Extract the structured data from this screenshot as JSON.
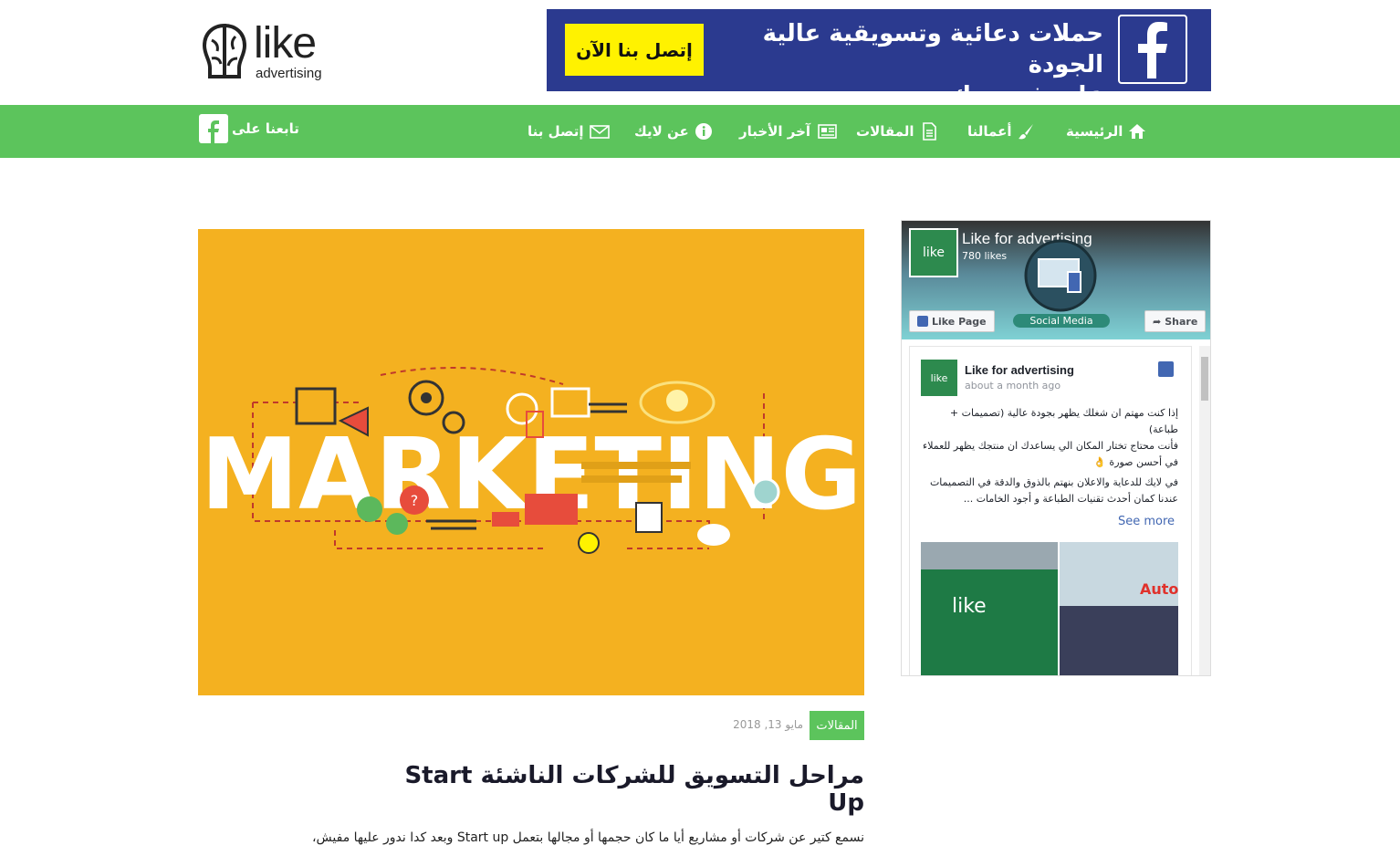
{
  "header": {
    "logo_word": "like",
    "logo_sub": "advertising"
  },
  "banner": {
    "cta_label": "إتصل بنا الآن",
    "headline_line1": "حملات دعائية وتسويقية عالية الجودة",
    "headline_line2": "على فيسبوك."
  },
  "nav": {
    "items": [
      {
        "label": "الرئيسية",
        "icon": "home-icon"
      },
      {
        "label": "أعمالنا",
        "icon": "brush-icon"
      },
      {
        "label": "المقالات",
        "icon": "document-icon"
      },
      {
        "label": "آخر الأخبار",
        "icon": "newspaper-icon"
      },
      {
        "label": "عن لايك",
        "icon": "info-icon"
      },
      {
        "label": "إتصل بنا",
        "icon": "envelope-icon"
      }
    ],
    "follow_label": "تابعنا على"
  },
  "hero": {
    "word": "MARKETING",
    "background": "#f4b120"
  },
  "post": {
    "category": "المقالات",
    "date": "مايو 13, 2018",
    "title": "مراحل التسويق للشركات الناشئة Start Up",
    "excerpt": "نسمع كتير عن شركات أو مشاريع أيا ما كان حجمها أو مجالها بتعمل Start up وبعد كدا ندور عليها مفيش،"
  },
  "fb_widget": {
    "page_name": "Like for advertising",
    "likes": "780 likes",
    "like_page_label": "Like Page",
    "share_label": "Share",
    "cover_caption": "Social Media",
    "cover_logo": "like",
    "feed_post": {
      "author": "Like for advertising",
      "time": "about a month ago",
      "body_lines": [
        "إذا كنت مهتم ان شغلك يظهر بجودة عالية (تصميمات + طباعة)",
        "فأنت محتاج تختار المكان الي يساعدك ان منتجك يظهر للعملاء في أحسن صورة 👌",
        "في لايك للدعاية والاعلان بنهتم بالذوق والدقة في التصميمات عندنا كمان أحدث تقنيات الطباعة و أجود الخامات ..."
      ],
      "see_more": "See more",
      "photo_right_text": "Auto"
    }
  },
  "colors": {
    "nav_green": "#5cc45c",
    "banner_blue": "#2b3a8f",
    "cta_yellow": "#fff200",
    "fb_blue": "#4267b2"
  }
}
